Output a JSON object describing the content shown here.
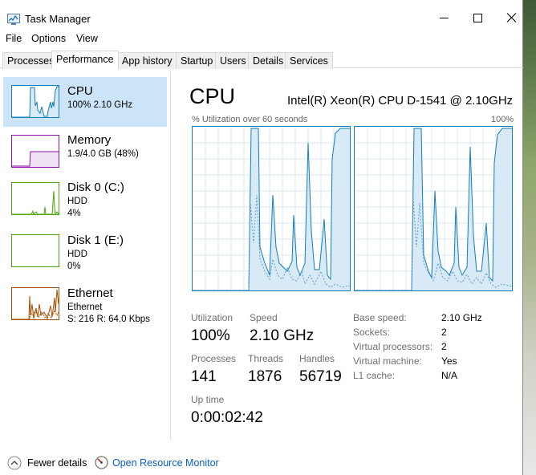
{
  "window": {
    "title": "Task Manager"
  },
  "menu": [
    "File",
    "Options",
    "View"
  ],
  "tabs": [
    "Processes",
    "Performance",
    "App history",
    "Startup",
    "Users",
    "Details",
    "Services"
  ],
  "active_tab": "Performance",
  "sidebar": {
    "items": [
      {
        "name": "CPU",
        "line1": "100%  2.10 GHz",
        "line2": ""
      },
      {
        "name": "Memory",
        "line1": "1.9/4.0 GB (48%)",
        "line2": ""
      },
      {
        "name": "Disk 0 (C:)",
        "line1": "HDD",
        "line2": "4%"
      },
      {
        "name": "Disk 1 (E:)",
        "line1": "HDD",
        "line2": "0%"
      },
      {
        "name": "Ethernet",
        "line1": "Ethernet",
        "line2": "S: 216  R: 64.0 Kbps"
      }
    ]
  },
  "main": {
    "title": "CPU",
    "cpu_model": "Intel(R) Xeon(R) CPU D-1541 @ 2.10GHz",
    "graph_label": "% Utilization over 60 seconds",
    "graph_max": "100%"
  },
  "stats": {
    "utilization_label": "Utilization",
    "utilization_value": "100%",
    "speed_label": "Speed",
    "speed_value": "2.10 GHz",
    "processes_label": "Processes",
    "processes_value": "141",
    "threads_label": "Threads",
    "threads_value": "1876",
    "handles_label": "Handles",
    "handles_value": "56719",
    "uptime_label": "Up time",
    "uptime_value": "0:00:02:42"
  },
  "specs": [
    {
      "label": "Base speed:",
      "value": "2.10 GHz"
    },
    {
      "label": "Sockets:",
      "value": "2"
    },
    {
      "label": "Virtual processors:",
      "value": "2"
    },
    {
      "label": "Virtual machine:",
      "value": "Yes"
    },
    {
      "label": "L1 cache:",
      "value": "N/A"
    }
  ],
  "footer": {
    "fewer_details": "Fewer details",
    "open_monitor": "Open Resource Monitor"
  },
  "colors": {
    "cpu": "#117dbb",
    "memory": "#8b12ae",
    "disk": "#4da60c",
    "ethernet": "#a74f01",
    "selected": "#cce4f7"
  }
}
